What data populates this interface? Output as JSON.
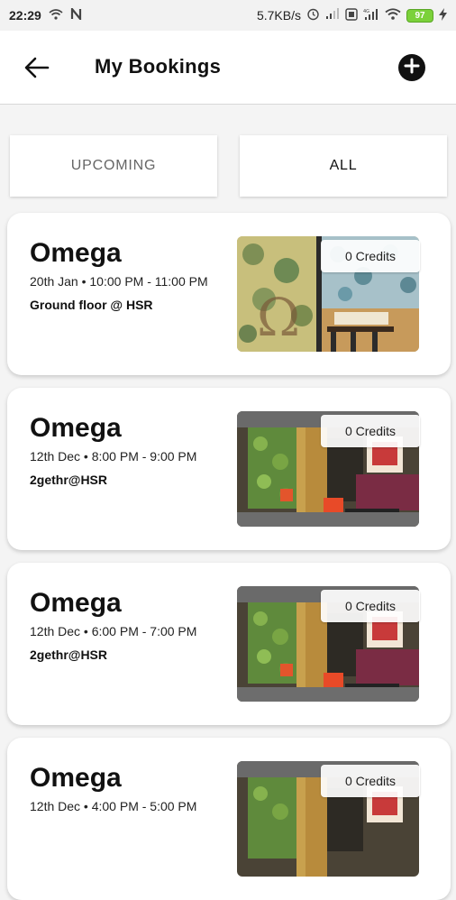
{
  "status_bar": {
    "time": "22:29",
    "network_speed": "5.7KB/s",
    "battery": "97",
    "icons": [
      "wifi-icon",
      "n-icon",
      "alarm-icon",
      "signal-icon",
      "volte-icon",
      "4g-signal-icon",
      "wifi-icon",
      "battery-icon",
      "charging-icon"
    ]
  },
  "header": {
    "title": "My Bookings",
    "back_icon": "arrow-left-icon",
    "add_icon": "plus-circle-icon"
  },
  "tabs": [
    {
      "label": "UPCOMING",
      "selected": false
    },
    {
      "label": "ALL",
      "selected": true
    }
  ],
  "bookings": [
    {
      "name": "Omega",
      "datetime": "20th Jan • 10:00 PM - 11:00 PM",
      "location": "Ground floor @ HSR",
      "credits": "0 Credits",
      "photo": "meeting-room-photo"
    },
    {
      "name": "Omega",
      "datetime": "12th Dec • 8:00 PM - 9:00 PM",
      "location": "2gethr@HSR",
      "credits": "0 Credits",
      "photo": "cafe-photo"
    },
    {
      "name": "Omega",
      "datetime": "12th Dec • 6:00 PM - 7:00 PM",
      "location": "2gethr@HSR",
      "credits": "0 Credits",
      "photo": "cafe-photo"
    },
    {
      "name": "Omega",
      "datetime": "12th Dec • 4:00 PM - 5:00 PM",
      "location": "",
      "credits": "0 Credits",
      "photo": "cafe-photo"
    }
  ],
  "colors": {
    "background": "#f4f4f4",
    "card": "#ffffff",
    "accent": "#111111",
    "battery": "#7bd13a"
  }
}
